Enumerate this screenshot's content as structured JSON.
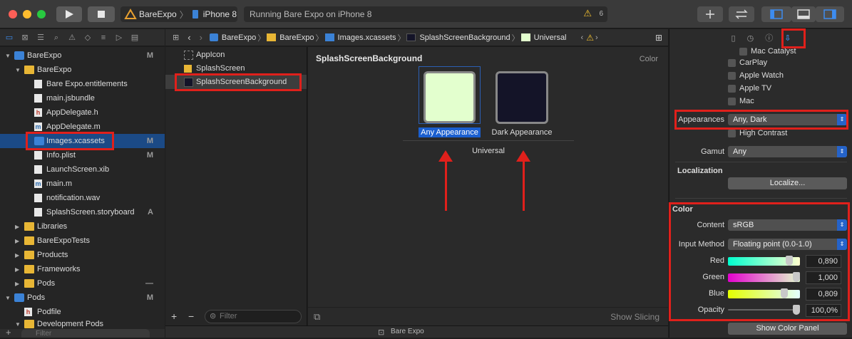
{
  "toolbar": {
    "scheme": "BareExpo",
    "device": "iPhone 8",
    "status": "Running Bare Expo on iPhone 8",
    "warnings": "6"
  },
  "navigator": {
    "items": [
      {
        "label": "BareExpo",
        "badge": "M"
      },
      {
        "label": "BareExpo",
        "badge": ""
      },
      {
        "label": "Bare Expo.entitlements",
        "badge": ""
      },
      {
        "label": "main.jsbundle",
        "badge": ""
      },
      {
        "label": "AppDelegate.h",
        "badge": ""
      },
      {
        "label": "AppDelegate.m",
        "badge": ""
      },
      {
        "label": "Images.xcassets",
        "badge": "M"
      },
      {
        "label": "Info.plist",
        "badge": "M"
      },
      {
        "label": "LaunchScreen.xib",
        "badge": ""
      },
      {
        "label": "main.m",
        "badge": ""
      },
      {
        "label": "notification.wav",
        "badge": ""
      },
      {
        "label": "SplashScreen.storyboard",
        "badge": "A"
      },
      {
        "label": "Libraries",
        "badge": ""
      },
      {
        "label": "BareExpoTests",
        "badge": ""
      },
      {
        "label": "Products",
        "badge": ""
      },
      {
        "label": "Frameworks",
        "badge": ""
      },
      {
        "label": "Pods",
        "badge": "—"
      },
      {
        "label": "Pods",
        "badge": "M"
      },
      {
        "label": "Podfile",
        "badge": ""
      },
      {
        "label": "Development Pods",
        "badge": ""
      }
    ],
    "filter_placeholder": "Filter"
  },
  "jumpbar": {
    "crumbs": [
      "BareExpo",
      "BareExpo",
      "Images.xcassets",
      "SplashScreenBackground",
      "Universal"
    ]
  },
  "assets": {
    "items": [
      "AppIcon",
      "SplashScreen",
      "SplashScreenBackground"
    ],
    "filter_placeholder": "Filter"
  },
  "editor": {
    "title": "SplashScreenBackground",
    "kind": "Color",
    "any_label": "Any Appearance",
    "dark_label": "Dark Appearance",
    "group_label": "Universal",
    "show_slicing": "Show Slicing",
    "any_color": "#E3FFCE",
    "dark_color": "#141428"
  },
  "inspector": {
    "devices": [
      "Mac Catalyst",
      "CarPlay",
      "Apple Watch",
      "Apple TV",
      "Mac"
    ],
    "appearances_label": "Appearances",
    "appearances_value": "Any, Dark",
    "high_contrast": "High Contrast",
    "gamut_label": "Gamut",
    "gamut_value": "Any",
    "localization_title": "Localization",
    "localize_button": "Localize...",
    "color_title": "Color",
    "content_label": "Content",
    "content_value": "sRGB",
    "input_label": "Input Method",
    "input_value": "Floating point (0.0-1.0)",
    "channels": [
      {
        "label": "Red",
        "value": "0,890",
        "level": 0.89
      },
      {
        "label": "Green",
        "value": "1,000",
        "level": 1.0
      },
      {
        "label": "Blue",
        "value": "0,809",
        "level": 0.809
      },
      {
        "label": "Opacity",
        "value": "100,0%",
        "level": 1.0
      }
    ],
    "show_color_panel": "Show Color Panel"
  },
  "bottombar": {
    "scheme": "Bare Expo"
  }
}
